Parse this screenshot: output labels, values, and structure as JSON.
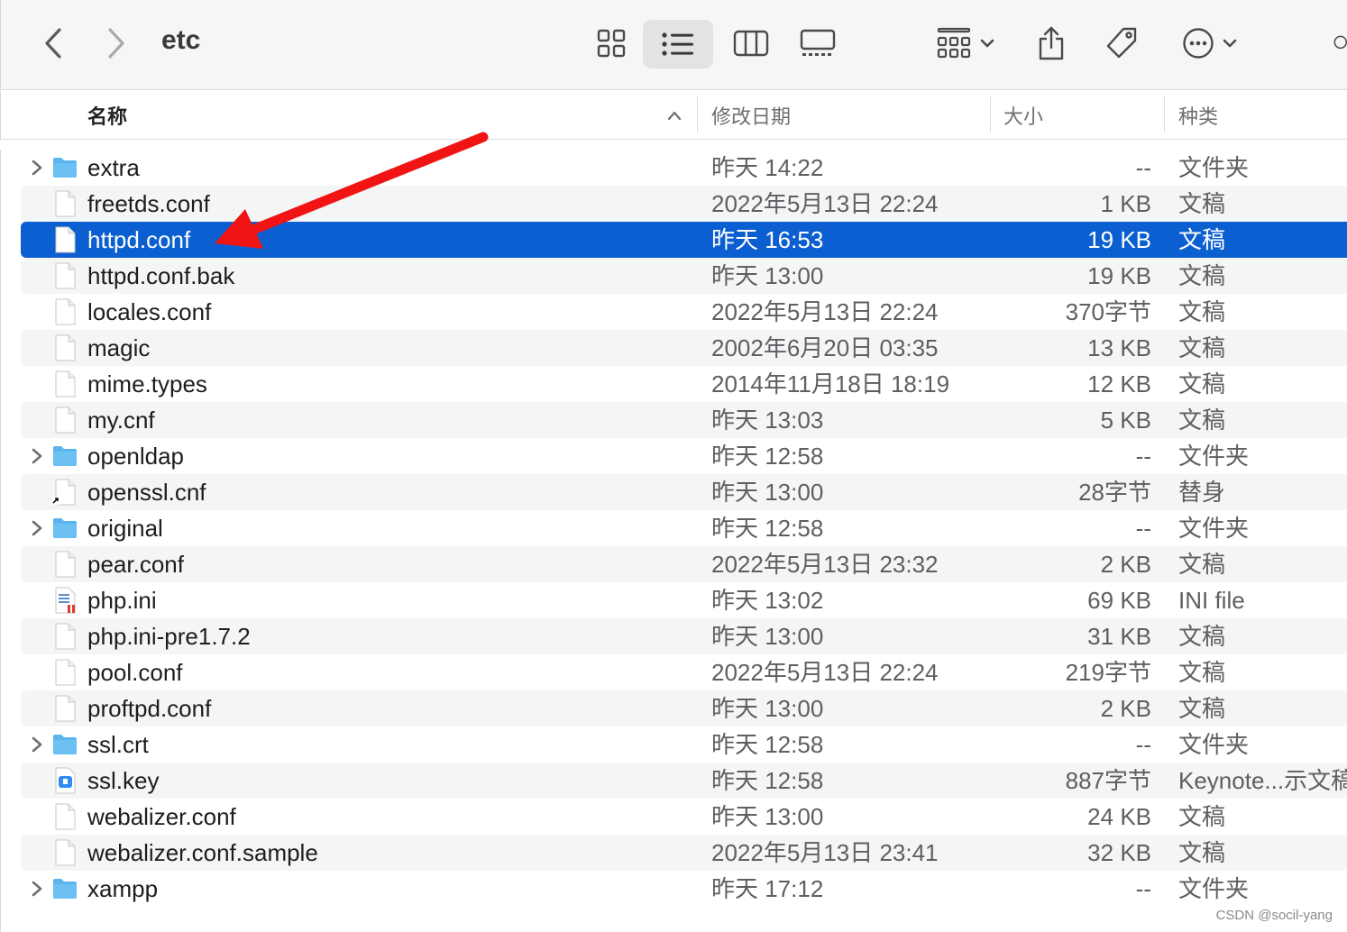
{
  "window": {
    "title": "etc"
  },
  "toolbar": {
    "back_icon": "chevron-left-icon",
    "forward_icon": "chevron-right-icon",
    "view_icons": [
      "icon-view-icon",
      "list-view-icon",
      "column-view-icon",
      "gallery-view-icon"
    ],
    "active_view": "list-view-icon",
    "group_icon": "group-by-icon",
    "share_icon": "share-icon",
    "tag_icon": "tag-icon",
    "more_icon": "more-actions-icon",
    "search_icon": "search-icon"
  },
  "columns": {
    "name": "名称",
    "date": "修改日期",
    "size": "大小",
    "kind": "种类"
  },
  "files": [
    {
      "name": "extra",
      "date": "昨天 14:22",
      "size": "--",
      "kind": "文件夹",
      "icon": "folder-icon",
      "expandable": true
    },
    {
      "name": "freetds.conf",
      "date": "2022年5月13日 22:24",
      "size": "1 KB",
      "kind": "文稿",
      "icon": "document-icon",
      "expandable": false
    },
    {
      "name": "httpd.conf",
      "date": "昨天 16:53",
      "size": "19 KB",
      "kind": "文稿",
      "icon": "document-icon",
      "expandable": false,
      "selected": true
    },
    {
      "name": "httpd.conf.bak",
      "date": "昨天 13:00",
      "size": "19 KB",
      "kind": "文稿",
      "icon": "document-icon",
      "expandable": false
    },
    {
      "name": "locales.conf",
      "date": "2022年5月13日 22:24",
      "size": "370字节",
      "kind": "文稿",
      "icon": "document-icon",
      "expandable": false
    },
    {
      "name": "magic",
      "date": "2002年6月20日 03:35",
      "size": "13 KB",
      "kind": "文稿",
      "icon": "document-icon",
      "expandable": false
    },
    {
      "name": "mime.types",
      "date": "2014年11月18日 18:19",
      "size": "12 KB",
      "kind": "文稿",
      "icon": "document-icon",
      "expandable": false
    },
    {
      "name": "my.cnf",
      "date": "昨天 13:03",
      "size": "5 KB",
      "kind": "文稿",
      "icon": "document-icon",
      "expandable": false
    },
    {
      "name": "openldap",
      "date": "昨天 12:58",
      "size": "--",
      "kind": "文件夹",
      "icon": "folder-icon",
      "expandable": true
    },
    {
      "name": "openssl.cnf",
      "date": "昨天 13:00",
      "size": "28字节",
      "kind": "替身",
      "icon": "alias-document-icon",
      "expandable": false
    },
    {
      "name": "original",
      "date": "昨天 12:58",
      "size": "--",
      "kind": "文件夹",
      "icon": "folder-icon",
      "expandable": true
    },
    {
      "name": "pear.conf",
      "date": "2022年5月13日 23:32",
      "size": "2 KB",
      "kind": "文稿",
      "icon": "document-icon",
      "expandable": false
    },
    {
      "name": "php.ini",
      "date": "昨天 13:02",
      "size": "69 KB",
      "kind": "INI file",
      "icon": "ini-file-icon",
      "expandable": false
    },
    {
      "name": "php.ini-pre1.7.2",
      "date": "昨天 13:00",
      "size": "31 KB",
      "kind": "文稿",
      "icon": "document-icon",
      "expandable": false
    },
    {
      "name": "pool.conf",
      "date": "2022年5月13日 22:24",
      "size": "219字节",
      "kind": "文稿",
      "icon": "document-icon",
      "expandable": false
    },
    {
      "name": "proftpd.conf",
      "date": "昨天 13:00",
      "size": "2 KB",
      "kind": "文稿",
      "icon": "document-icon",
      "expandable": false
    },
    {
      "name": "ssl.crt",
      "date": "昨天 12:58",
      "size": "--",
      "kind": "文件夹",
      "icon": "folder-icon",
      "expandable": true
    },
    {
      "name": "ssl.key",
      "date": "昨天 12:58",
      "size": "887字节",
      "kind": "Keynote...示文稿",
      "icon": "keynote-file-icon",
      "expandable": false
    },
    {
      "name": "webalizer.conf",
      "date": "昨天 13:00",
      "size": "24 KB",
      "kind": "文稿",
      "icon": "document-icon",
      "expandable": false
    },
    {
      "name": "webalizer.conf.sample",
      "date": "2022年5月13日 23:41",
      "size": "32 KB",
      "kind": "文稿",
      "icon": "document-icon",
      "expandable": false
    },
    {
      "name": "xampp",
      "date": "昨天 17:12",
      "size": "--",
      "kind": "文件夹",
      "icon": "folder-icon",
      "expandable": true
    }
  ],
  "annotation": {
    "arrow_color": "#f01414",
    "target": "httpd.conf"
  },
  "colors": {
    "selection": "#0b5fd0",
    "folder": "#5ab4ee"
  },
  "watermark": "CSDN @socil-yang"
}
